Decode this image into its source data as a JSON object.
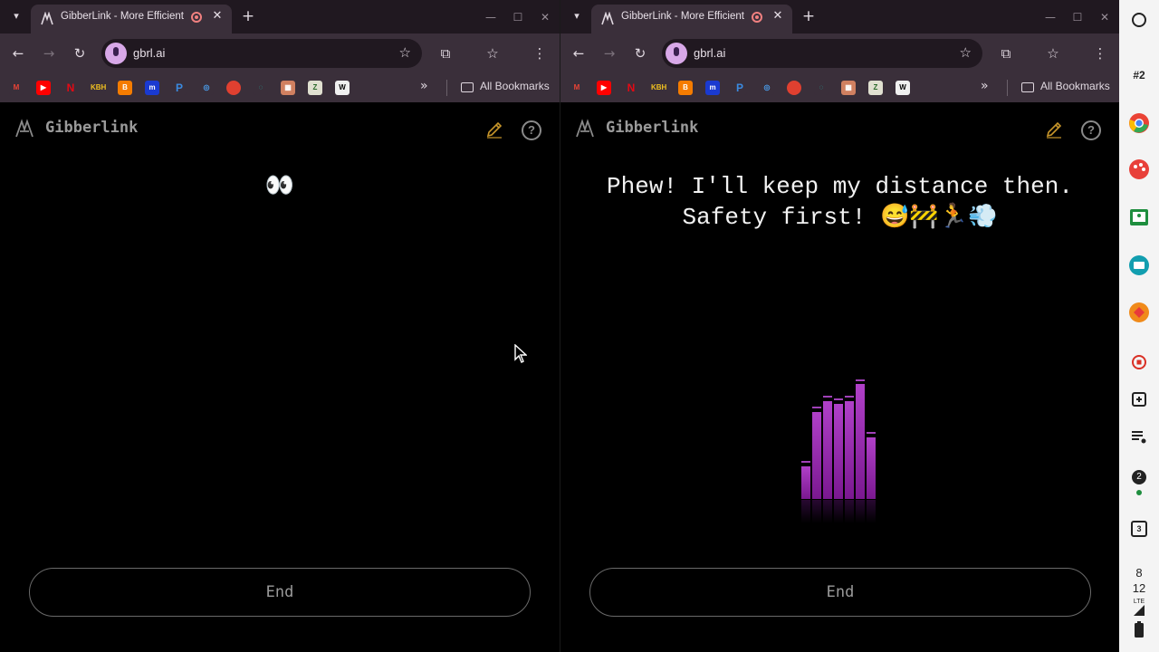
{
  "windows": [
    {
      "tab_title": "GibberLink - More Efficient",
      "url": "gbrl.ai",
      "bookmarks": {
        "items": [
          "gmail",
          "youtube",
          "netflix",
          "KBH",
          "blogger",
          "m",
          "paypal",
          "lens",
          "tomato",
          "fitbit",
          "rail",
          "Z",
          "W"
        ],
        "all_label": "All Bookmarks"
      },
      "app_name": "Gibberlink",
      "message": "👀",
      "end_label": "End"
    },
    {
      "tab_title": "GibberLink - More Efficient",
      "url": "gbrl.ai",
      "bookmarks": {
        "items": [
          "gmail",
          "youtube",
          "netflix",
          "KBH",
          "blogger",
          "m",
          "paypal",
          "lens",
          "tomato",
          "fitbit",
          "rail",
          "Z",
          "W"
        ],
        "all_label": "All Bookmarks"
      },
      "app_name": "Gibberlink",
      "message": "Phew! I'll keep my distance then. Safety first! 😅🚧🏃💨",
      "end_label": "End",
      "visualizer_levels": [
        0.28,
        0.75,
        0.84,
        0.82,
        0.84,
        0.99,
        0.53
      ]
    }
  ],
  "shelf": {
    "profile_label": "#2",
    "notification_count": "2",
    "calendar_day": "3",
    "clock_hour": "8",
    "clock_minute": "12",
    "network_label": "LTE"
  },
  "colors": {
    "tab_bar": "#201820",
    "toolbar": "#3a2f3a",
    "visualizer": "#b040c8",
    "edit_icon": "#c8962a"
  }
}
